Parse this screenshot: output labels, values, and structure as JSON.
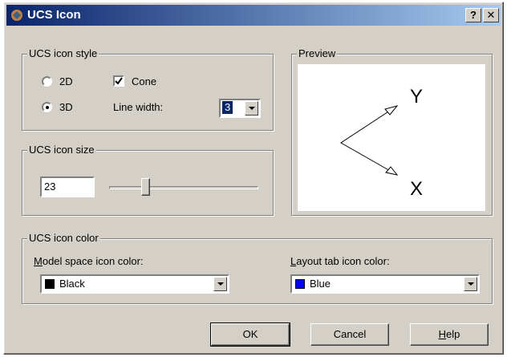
{
  "window": {
    "title": "UCS Icon",
    "help_label": "?",
    "close_label": "✕"
  },
  "style_group": {
    "legend": "UCS icon style",
    "radio_2d": "2D",
    "radio_3d": "3D",
    "selected": "3D",
    "cone_label": "Cone",
    "cone_checked": true,
    "line_width_label": "Line width:",
    "line_width_value": "3"
  },
  "preview_group": {
    "legend": "Preview",
    "axis_y": "Y",
    "axis_x": "X"
  },
  "size_group": {
    "legend": "UCS icon size",
    "value": "23",
    "slider_fraction": 0.23
  },
  "color_group": {
    "legend": "UCS icon color",
    "model_label": "Model space icon color:",
    "model_value": "Black",
    "model_color": "#000000",
    "layout_label": "Layout tab icon color:",
    "layout_value": "Blue",
    "layout_color": "#0000ff"
  },
  "buttons": {
    "ok": "OK",
    "cancel": "Cancel",
    "help": "Help"
  }
}
